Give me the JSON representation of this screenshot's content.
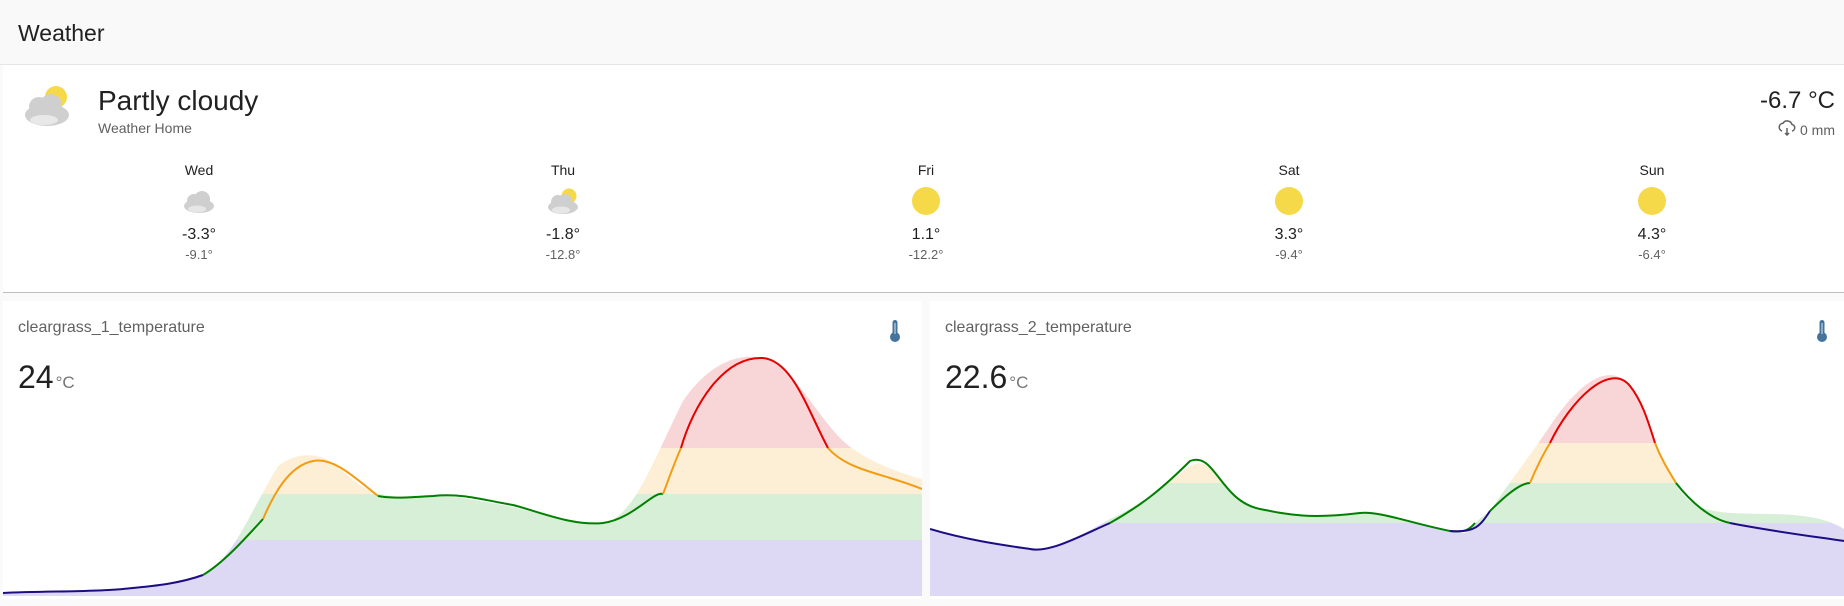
{
  "header": {
    "title": "Weather"
  },
  "current": {
    "condition": "Partly cloudy",
    "location": "Weather Home",
    "temperature": "-6.7 °C",
    "precipitation": "0 mm",
    "icon": "partly-cloudy-icon"
  },
  "forecast": [
    {
      "day": "Wed",
      "icon": "cloudy-icon",
      "high": "-3.3°",
      "low": "-9.1°"
    },
    {
      "day": "Thu",
      "icon": "partly-cloudy-icon",
      "high": "-1.8°",
      "low": "-12.8°"
    },
    {
      "day": "Fri",
      "icon": "sunny-icon",
      "high": "1.1°",
      "low": "-12.2°"
    },
    {
      "day": "Sat",
      "icon": "sunny-icon",
      "high": "3.3°",
      "low": "-9.4°"
    },
    {
      "day": "Sun",
      "icon": "sunny-icon",
      "high": "4.3°",
      "low": "-6.4°"
    }
  ],
  "sensors": [
    {
      "name": "cleargrass_1_temperature",
      "value": "24",
      "unit": "°C",
      "icon": "thermometer-icon"
    },
    {
      "name": "cleargrass_2_temperature",
      "value": "22.6",
      "unit": "°C",
      "icon": "thermometer-icon"
    }
  ],
  "colors": {
    "sun": "#f5d949",
    "cloud": "#cccccc",
    "thermometer": "#44739e",
    "band_low": "#1c0d82",
    "band_mid": "#008000",
    "band_warm": "#f39c12",
    "band_hot": "#e60000"
  }
}
